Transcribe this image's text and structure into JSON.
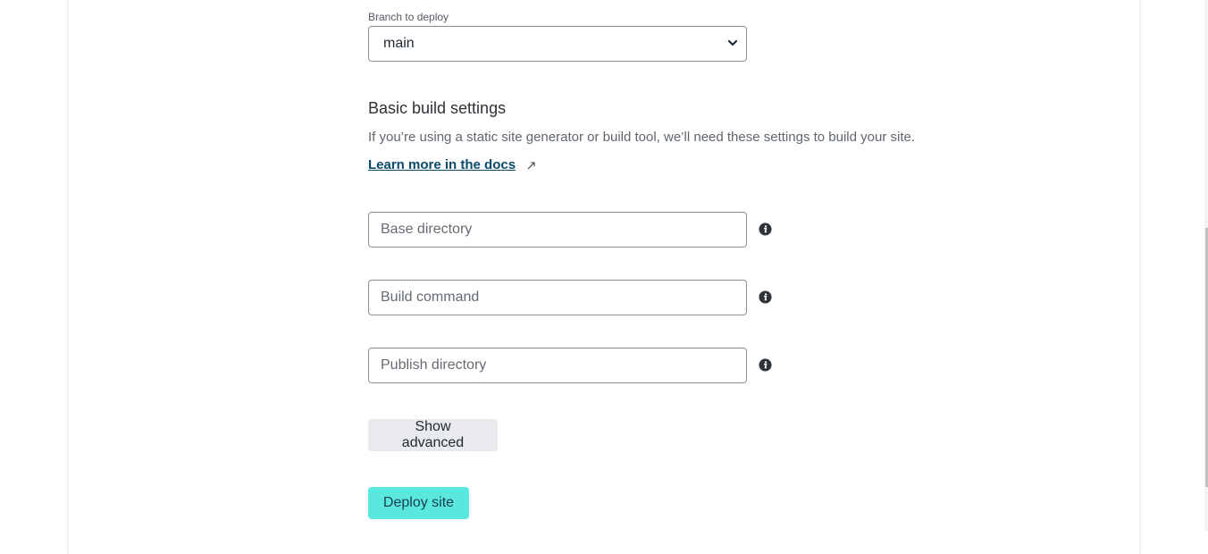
{
  "branch": {
    "label": "Branch to deploy",
    "selected": "main"
  },
  "build_settings": {
    "title": "Basic build settings",
    "description": "If you’re using a static site generator or build tool, we’ll need these settings to build your site.",
    "docs_link": "Learn more in the docs",
    "fields": [
      {
        "placeholder": "Base directory",
        "value": "",
        "info_icon": "info-icon"
      },
      {
        "placeholder": "Build command",
        "value": "",
        "info_icon": "info-icon"
      },
      {
        "placeholder": "Publish directory",
        "value": "",
        "info_icon": "info-icon"
      }
    ]
  },
  "buttons": {
    "show_advanced": "Show advanced",
    "deploy": "Deploy site"
  },
  "colors": {
    "deploy_button": "#5ae8de",
    "link": "#0a4a6b",
    "secondary_button": "#e8eaed"
  }
}
